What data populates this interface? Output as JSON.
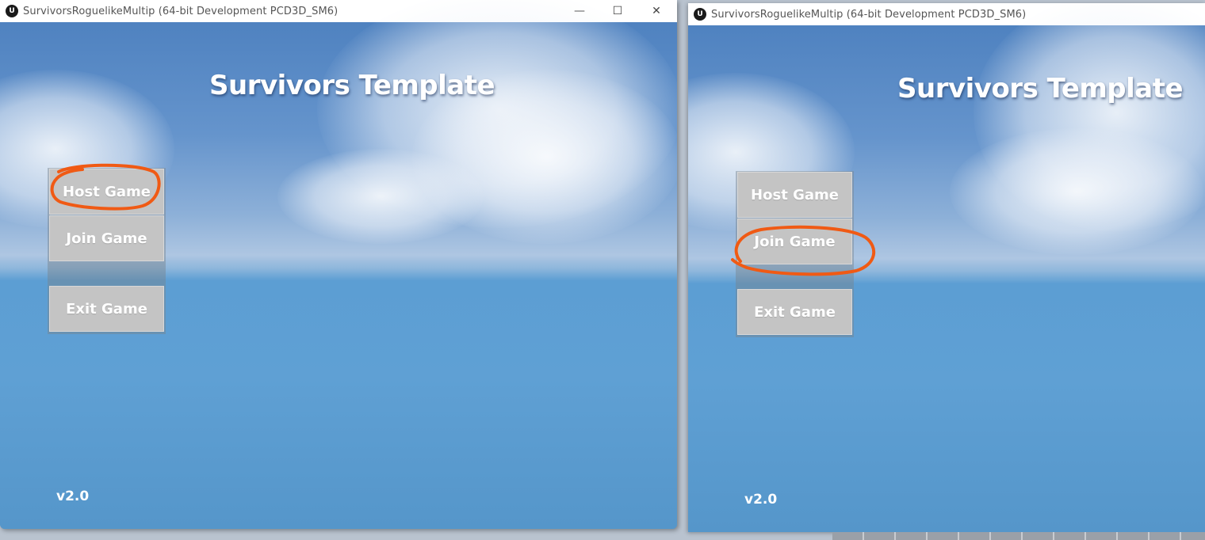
{
  "windows": [
    {
      "title": "SurvivorsRoguelikeMultip (64-bit Development PCD3D_SM6)",
      "logo_text": "U",
      "controls": {
        "minimize": "—",
        "maximize": "☐",
        "close": "✕"
      },
      "game_title": "Survivors Template",
      "menu": {
        "host": "Host Game",
        "join": "Join Game",
        "exit": "Exit Game"
      },
      "version": "v2.0",
      "highlighted_button": "host"
    },
    {
      "title": "SurvivorsRoguelikeMultip (64-bit Development PCD3D_SM6)",
      "logo_text": "U",
      "game_title": "Survivors Template",
      "menu": {
        "host": "Host Game",
        "join": "Join Game",
        "exit": "Exit Game"
      },
      "version": "v2.0",
      "highlighted_button": "join"
    }
  ],
  "colors": {
    "annotation": "#f05a14",
    "button_face": "#c4c4c4",
    "sky_top": "#4f82c0",
    "sea": "#5fa0d4"
  },
  "icons": {
    "app_logo": "unreal-engine-icon"
  }
}
